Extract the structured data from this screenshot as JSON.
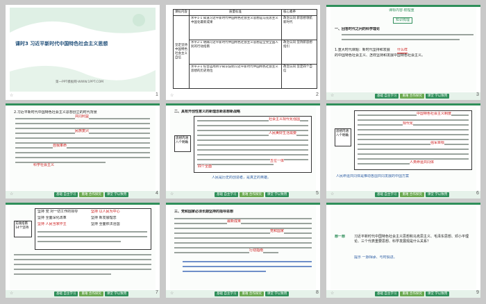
{
  "nav_buttons": [
    "基础 自主学习",
    "重难 合作探究",
    "课堂 学以致用"
  ],
  "slides": [
    {
      "number": "1",
      "title": "课时3 习近平新时代中国特色社会主义思想",
      "footer": "第一PPT模板网-WWW.1PPT.COM"
    },
    {
      "number": "2",
      "table_headers": [
        "课标内容",
        "质量标准",
        "核心素养"
      ],
      "left_cell": "坚定坚持中国特色社会主义自信",
      "rows": [
        "水平1-1 知道习近平新时代中国特色社会主义思想是马克思主义中国化最新成果",
        "水平2-1 明确习近平新时代中国特色社会主义思想是全党全国人民的行动指南",
        "水平3-1 综合运用所学知识说明习近平新时代中国特色社会主义思想的历史地位"
      ],
      "right_cells": [
        "政治认同 新思想领航新时代",
        "政治认同 坚持新思想指引",
        "政治认同 坚定四个自信"
      ]
    },
    {
      "number": "3",
      "header": "课标内容·梳理重",
      "section": "知识梳理",
      "item_1": "一、回答时代之问的科学理论",
      "highlight_1": "时代之问",
      "item_2": "1.重大时代课题：新时代坚持和发展",
      "highlight_2": "什么样",
      "item_2_tail": "的中国特色社会主义、怎样坚持和发展中国特色社会主义。"
    },
    {
      "number": "4",
      "item_1": "2.习近平新时代中国特色社会主义思想创立的时代背景",
      "highlight_1": "共同利益",
      "highlight_2": "民族复兴",
      "highlight_3": "自我革命",
      "highlight_4": "科学社会主义"
    },
    {
      "number": "5",
      "title": "二、具有开创性意义的新理念新思想新战略",
      "left_label": "思想内涵八个明确",
      "highlight_1": "社会主义现代化强国",
      "highlight_2": "人民美好生活需要",
      "highlight_3": "四个全面",
      "highlight_4": "五位一体",
      "footer": "人民是历史的创造者，是真正的英雄。"
    },
    {
      "number": "6",
      "left_label": "思想内涵八个明确",
      "highlight_1": "中国特色社会主义制度",
      "highlight_2": "现代化",
      "highlight_3": "强军目标",
      "highlight_4": "人类命运共同体",
      "footer": "人民命运共同体是推动各国共同发展的中国方案"
    },
    {
      "number": "7",
      "left_label": "实践指南14个坚持",
      "items": [
        "坚持 党 对一切工作的领导",
        "坚持 以人民为中心",
        "坚持 全面深化改革",
        "坚持 新发展理念",
        "坚持 人民当家作主",
        "坚持 全面依法治国"
      ]
    },
    {
      "number": "8",
      "title": "三、党和国家必须长期坚持的指导思想",
      "highlight_1": "最新成果",
      "highlight_2": "党和国家",
      "highlight_3": "行动指南"
    },
    {
      "number": "9",
      "think": "想一想",
      "question": "习近平新时代中国特色社会主义思想和马克思主义、毛泽东思想、邓小平理论、三个代表重要思想、科学发展观是什么关系？",
      "hint": "提示 一脉相承、与时俱进。"
    }
  ]
}
